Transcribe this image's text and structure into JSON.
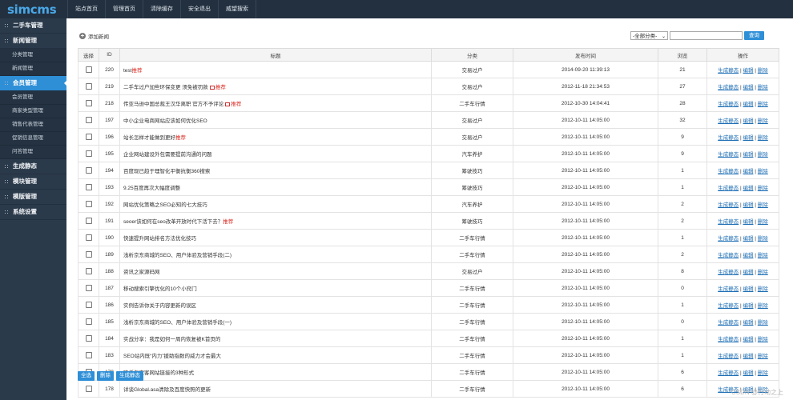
{
  "app": {
    "logo": "simcms"
  },
  "topnav": [
    {
      "label": "站点首页"
    },
    {
      "label": "管理首页"
    },
    {
      "label": "清除缓存"
    },
    {
      "label": "安全退出"
    },
    {
      "label": "威望搜索"
    }
  ],
  "sidebar": {
    "groups": [
      {
        "label": "二手车管理",
        "subs": []
      },
      {
        "label": "新闻管理",
        "subs": [
          "分类管理",
          "新闻管理"
        ]
      },
      {
        "label": "会员管理",
        "active": true,
        "subs": [
          "会员管理",
          "商家类型管理",
          "销售代表管理",
          "促销信息管理",
          "问答管理"
        ]
      },
      {
        "label": "生成静态",
        "subs": []
      },
      {
        "label": "模块管理",
        "subs": []
      },
      {
        "label": "模版管理",
        "subs": []
      },
      {
        "label": "系统设置",
        "subs": []
      }
    ]
  },
  "toolbar": {
    "add_label": "添加新闻",
    "category_select": "-全部分类-",
    "search_value": "",
    "search_button": "查询"
  },
  "table": {
    "headers": [
      "选择",
      "ID",
      "标题",
      "分类",
      "发布时间",
      "浏览",
      "操作"
    ],
    "op_labels": [
      "生成静态",
      "编辑",
      "删除"
    ],
    "rows": [
      {
        "id": "220",
        "title": "test",
        "img": false,
        "tag": "推荐",
        "category": "交易过户",
        "date": "2014-09-20 11:39:13",
        "views": "21"
      },
      {
        "id": "219",
        "title": "二手车过户加些环保变更 须免被罚款",
        "img": true,
        "tag": "推荐",
        "category": "交易过户",
        "date": "2012-11-18 21:34:53",
        "views": "27"
      },
      {
        "id": "218",
        "title": "传亚马逊中国总裁王汉华离职 官方不予评论",
        "img": true,
        "tag": "推荐",
        "category": "二手车行情",
        "date": "2012-10-30 14:04:41",
        "views": "28"
      },
      {
        "id": "197",
        "title": "中小企业电商网站应该如何优化SEO",
        "img": false,
        "tag": "",
        "category": "交易过户",
        "date": "2012-10-11 14:05:00",
        "views": "32"
      },
      {
        "id": "196",
        "title": "站长怎样才能做到更好",
        "img": false,
        "tag": "推荐",
        "category": "交易过户",
        "date": "2012-10-11 14:05:00",
        "views": "9"
      },
      {
        "id": "195",
        "title": "企业网站建设外包需要提前沟通的问题",
        "img": false,
        "tag": "",
        "category": "汽车养护",
        "date": "2012-10-11 14:05:00",
        "views": "9"
      },
      {
        "id": "194",
        "title": "百度现已趋于理智化平衡抗衡360搜索",
        "img": false,
        "tag": "",
        "category": "筹驶技巧",
        "date": "2012-10-11 14:05:00",
        "views": "1"
      },
      {
        "id": "193",
        "title": "9.25百度再次大幅度调整",
        "img": false,
        "tag": "",
        "category": "筹驶技巧",
        "date": "2012-10-11 14:05:00",
        "views": "1"
      },
      {
        "id": "192",
        "title": "网站优化策略之SEO必知的七大技巧",
        "img": false,
        "tag": "",
        "category": "汽车养护",
        "date": "2012-10-11 14:05:00",
        "views": "2"
      },
      {
        "id": "191",
        "title": "seoer该如何在seo改革开放时代下活下去？",
        "img": false,
        "tag": "推荐",
        "category": "筹驶技巧",
        "date": "2012-10-11 14:05:00",
        "views": "2"
      },
      {
        "id": "190",
        "title": "快速提升网站排名方法优化技巧",
        "img": false,
        "tag": "",
        "category": "二手车行情",
        "date": "2012-10-11 14:05:00",
        "views": "1"
      },
      {
        "id": "189",
        "title": "浅析京东商城的SEO、用户体验及营销手段(二)",
        "img": false,
        "tag": "",
        "category": "二手车行情",
        "date": "2012-10-11 14:05:00",
        "views": "2"
      },
      {
        "id": "188",
        "title": "资讯之家源码网",
        "img": false,
        "tag": "",
        "category": "交易过户",
        "date": "2012-10-11 14:05:00",
        "views": "8"
      },
      {
        "id": "187",
        "title": "移动搜索引擎优化的10个小窍门",
        "img": false,
        "tag": "",
        "category": "二手车行情",
        "date": "2012-10-11 14:05:00",
        "views": "0"
      },
      {
        "id": "186",
        "title": "实例告诉你关于内容更新的误区",
        "img": false,
        "tag": "",
        "category": "二手车行情",
        "date": "2012-10-11 14:05:00",
        "views": "1"
      },
      {
        "id": "185",
        "title": "浅析京东商城的SEO、用户体验及营销手段(一)",
        "img": false,
        "tag": "",
        "category": "二手车行情",
        "date": "2012-10-11 14:05:00",
        "views": "0"
      },
      {
        "id": "184",
        "title": "实战分享：我是如何一周内恢复被K首页的",
        "img": false,
        "tag": "",
        "category": "二手车行情",
        "date": "2012-10-11 14:05:00",
        "views": "1"
      },
      {
        "id": "183",
        "title": "SEO站内既“内力”援助指数的威力才会最大",
        "img": false,
        "tag": "",
        "category": "二手车行情",
        "date": "2012-10-11 14:05:00",
        "views": "1"
      },
      {
        "id": "179",
        "title": "降低淘宝客网站链接的3种形式",
        "img": false,
        "tag": "",
        "category": "二手车行情",
        "date": "2012-10-11 14:05:00",
        "views": "6"
      },
      {
        "id": "178",
        "title": "详谈Global.asa清除及百度快照的更新",
        "img": false,
        "tag": "",
        "category": "二手车行情",
        "date": "2012-10-11 14:05:00",
        "views": "6"
      }
    ]
  },
  "bottom": {
    "select_all": "全选",
    "delete": "删除",
    "generate": "生成静态"
  },
  "watermark": "CSDN @行动之上"
}
